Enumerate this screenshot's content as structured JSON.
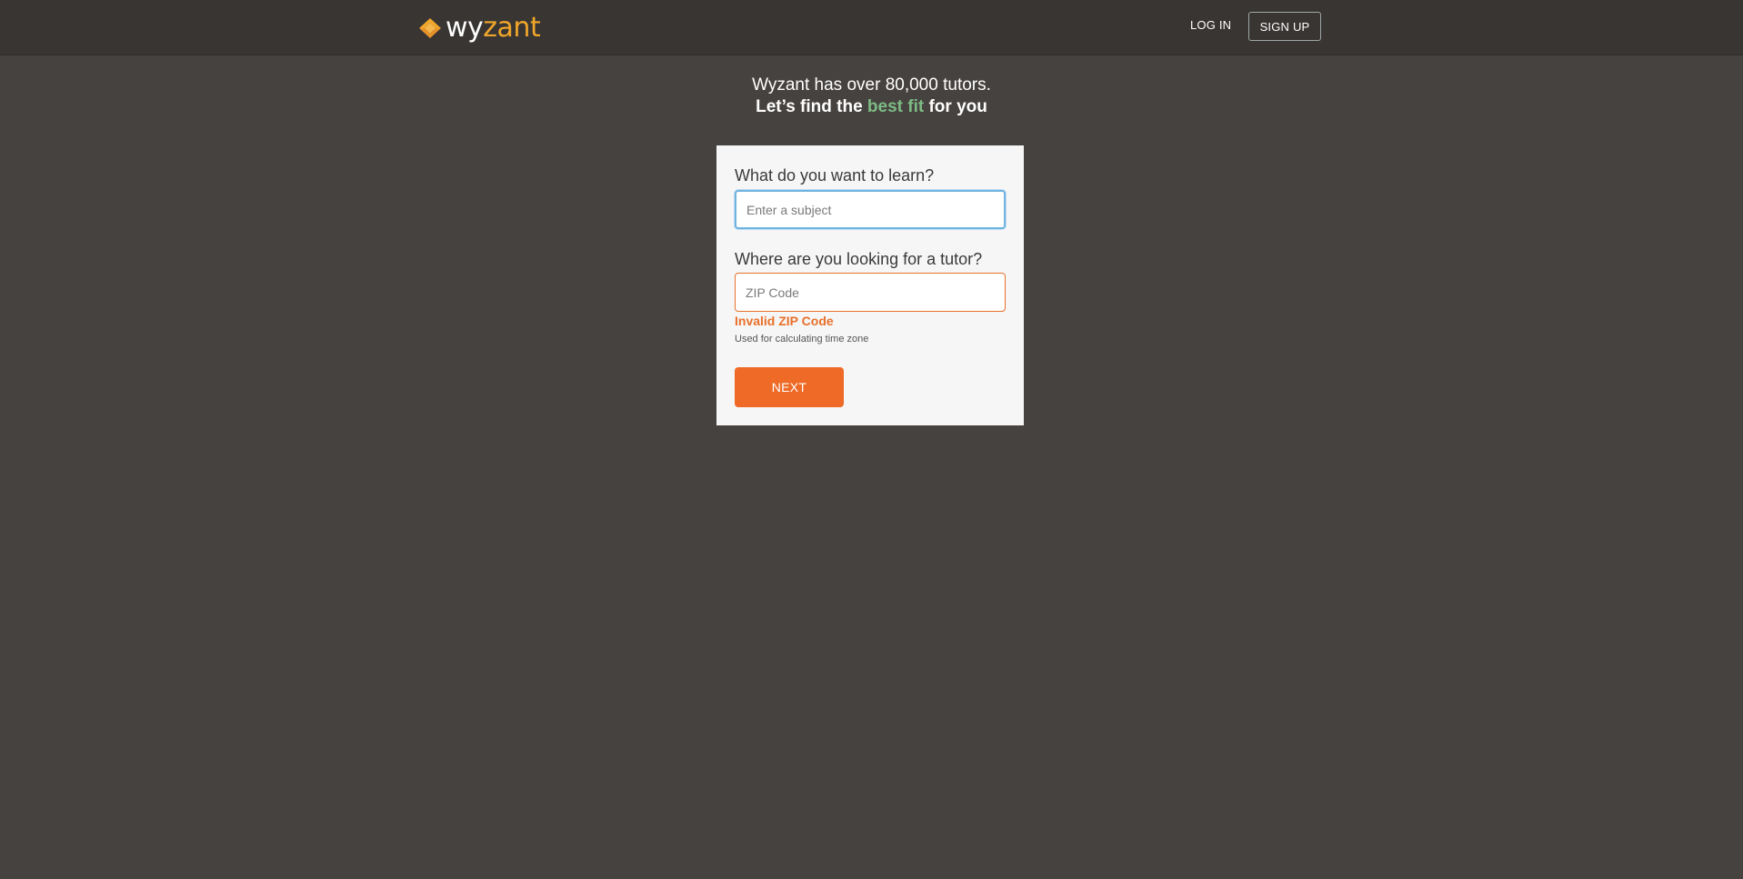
{
  "header": {
    "logo": {
      "icon": "wyzant-diamond-logo-icon",
      "text_part1": "wy",
      "text_part2": "zant",
      "brand_color": "#f0a62a"
    },
    "login_label": "LOG IN",
    "signup_label": "SIGN UP"
  },
  "hero": {
    "line1": "Wyzant has over 80,000 tutors.",
    "line2_before": "Let’s find the ",
    "line2_accent": "best fit",
    "line2_after": " for you",
    "accent_color": "#7dbb84"
  },
  "form": {
    "subject_label": "What do you want to learn?",
    "subject_value": "",
    "subject_placeholder": "Enter a subject",
    "location_label": "Where are you looking for a tutor?",
    "zip_value": "",
    "zip_placeholder": "ZIP Code",
    "zip_error": "Invalid ZIP Code",
    "zip_help": "Used for calculating time zone",
    "next_label": "NEXT",
    "button_color": "#ee6a26",
    "error_color": "#e8702a",
    "focus_color": "#6fb3e0"
  }
}
